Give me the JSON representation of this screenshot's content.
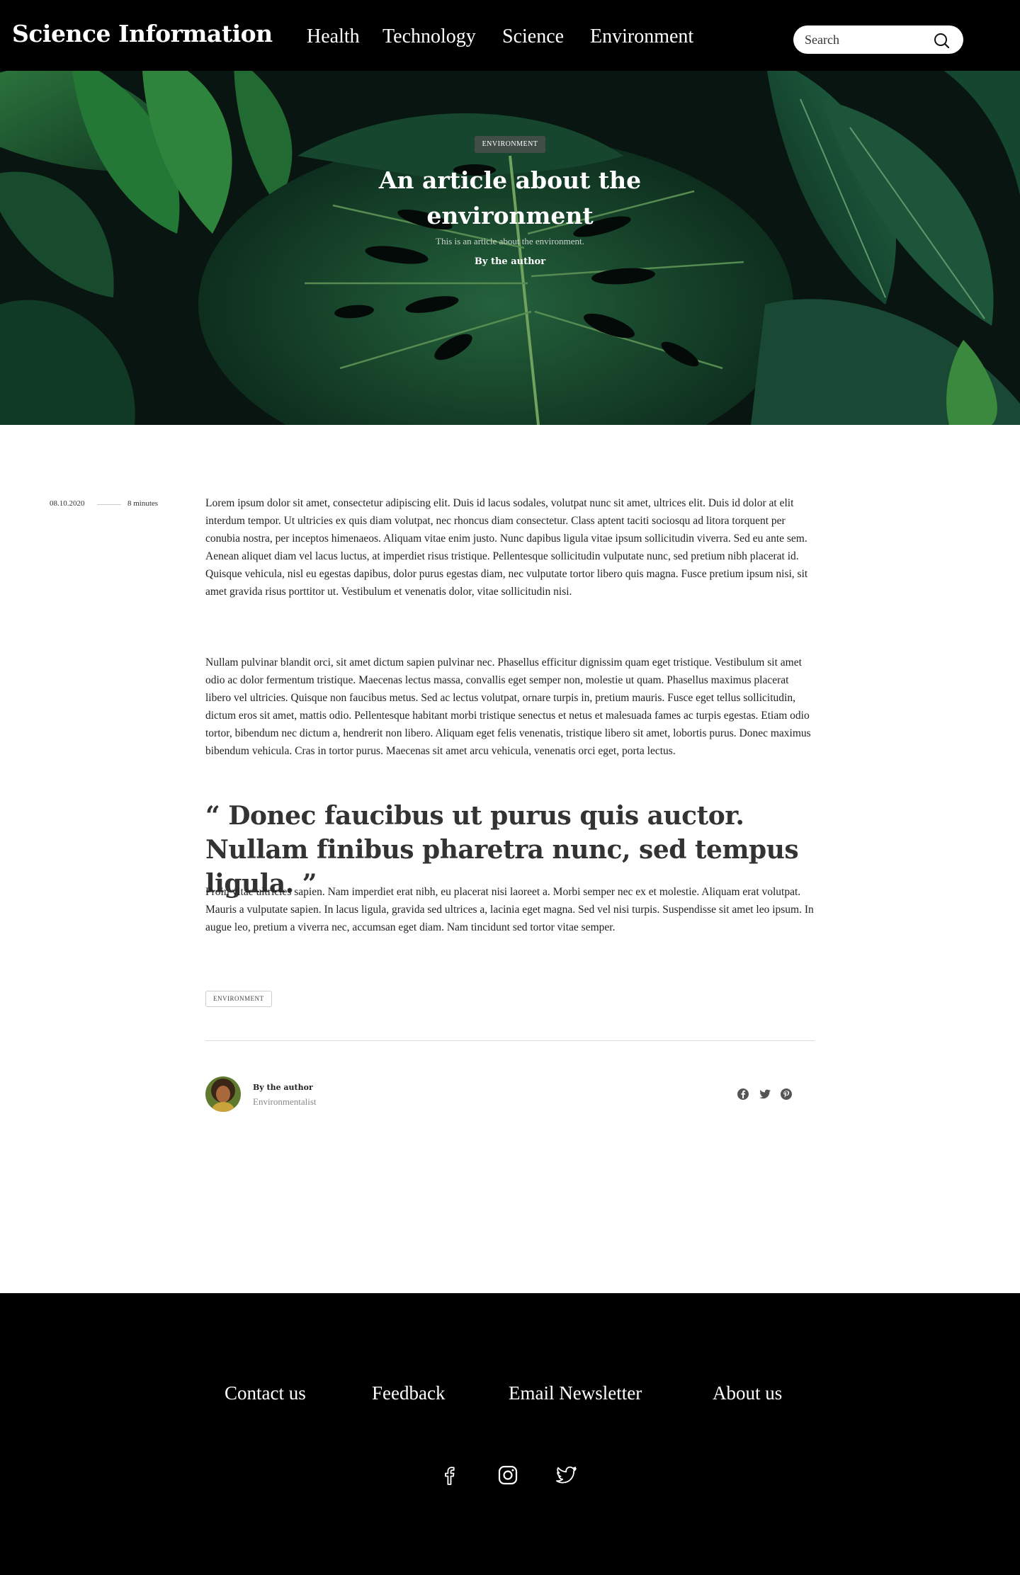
{
  "header": {
    "brand": "Science Information",
    "nav": [
      "Health",
      "Technology",
      "Science",
      "Environment"
    ],
    "search_placeholder": "Search"
  },
  "hero": {
    "tag": "ENVIRONMENT",
    "title": "An article about the environment",
    "subtitle": "This is an article about the environment.",
    "author": "By the author"
  },
  "article": {
    "date": "08.10.2020",
    "read_time": "8 minutes",
    "paragraphs": [
      "Lorem ipsum dolor sit amet, consectetur adipiscing elit. Duis id lacus sodales, volutpat nunc sit amet, ultrices elit. Duis id dolor at elit interdum tempor. Ut ultricies ex quis diam volutpat, nec rhoncus diam consectetur. Class aptent taciti sociosqu ad litora torquent per conubia nostra, per inceptos himenaeos. Aliquam vitae enim justo. Nunc dapibus ligula vitae ipsum sollicitudin viverra. Sed eu ante sem. Aenean aliquet diam vel lacus luctus, at imperdiet risus tristique. Pellentesque sollicitudin vulputate nunc, sed pretium nibh placerat id. Quisque vehicula, nisl eu egestas dapibus, dolor purus egestas diam, nec vulputate tortor libero quis magna. Fusce pretium ipsum nisi, sit amet gravida risus porttitor ut. Vestibulum et venenatis dolor, vitae sollicitudin nisi.",
      "Nullam pulvinar blandit orci, sit amet dictum sapien pulvinar nec. Phasellus efficitur dignissim quam eget tristique. Vestibulum sit amet odio ac dolor fermentum tristique. Maecenas lectus massa, convallis eget semper non, molestie ut quam. Phasellus maximus placerat libero vel ultricies. Quisque non faucibus metus. Sed ac lectus volutpat, ornare turpis in, pretium mauris. Fusce eget tellus sollicitudin, dictum eros sit amet, mattis odio. Pellentesque habitant morbi tristique senectus et netus et malesuada fames ac turpis egestas. Etiam odio tortor, bibendum nec dictum a, hendrerit non libero. Aliquam eget felis venenatis, tristique libero sit amet, lobortis purus. Donec maximus bibendum vehicula. Cras in tortor purus. Maecenas sit amet arcu vehicula, venenatis orci eget, porta lectus.",
      "Proin vitae ultricies sapien. Nam imperdiet erat nibh, eu placerat nisi laoreet a. Morbi semper nec ex et molestie. Aliquam erat volutpat. Mauris a vulputate sapien. In lacus ligula, gravida sed ultrices a, lacinia eget magna. Sed vel nisi turpis. Suspendisse sit amet leo ipsum. In augue leo, pretium a viverra nec, accumsan eget diam. Nam tincidunt sed tortor vitae semper."
    ],
    "quote": "“ Donec faucibus ut purus quis auctor. Nullam finibus pharetra nunc, sed tempus ligula. ”",
    "tag": "ENVIRONMENT"
  },
  "author": {
    "name": "By the author",
    "role": "Environmentalist",
    "share_icons": [
      "facebook-icon",
      "twitter-icon",
      "pinterest-icon"
    ]
  },
  "footer": {
    "links": [
      "Contact us",
      "Feedback",
      "Email Newsletter",
      "About us"
    ],
    "social_icons": [
      "facebook-icon",
      "instagram-icon",
      "twitter-icon"
    ]
  }
}
